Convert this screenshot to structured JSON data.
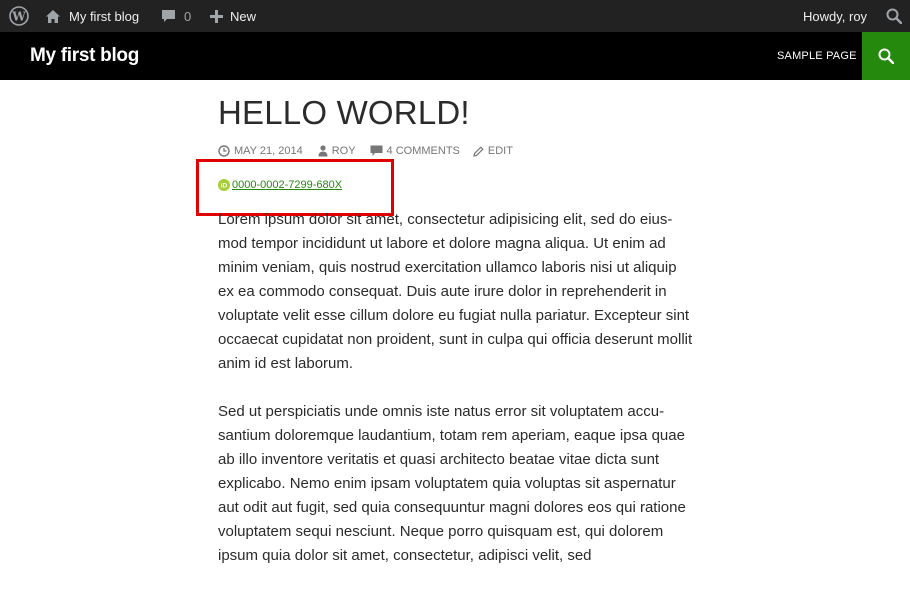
{
  "adminbar": {
    "site_name": "My first blog",
    "comments_count": "0",
    "new_label": "New",
    "howdy": "Howdy, roy",
    "icons": [
      "wordpress-icon",
      "home-icon",
      "comment-icon",
      "plus-icon",
      "search-icon"
    ]
  },
  "header": {
    "site_title": "My first blog",
    "nav": [
      "SAMPLE PAGE"
    ],
    "accent_color": "#24890d"
  },
  "post": {
    "title": "HELLO WORLD!",
    "date": "MAY 21, 2014",
    "author": "ROY",
    "comments": "4 COMMENTS",
    "edit": "EDIT",
    "orcid": "0000-0002-7299-680X",
    "paragraphs": [
      "Lorem ipsum dolor sit amet, consectetur adipisicing elit, sed do eius­mod tempor incididunt ut labore et dolore magna aliqua. Ut enim ad minim veniam, quis nostrud exercitation ullamco laboris nisi ut aliquip ex ea commodo consequat. Duis aute irure dolor in reprehen­derit in voluptate velit esse cillum dolore eu fugiat nulla pariatur. Ex­cepteur sint occaecat cupidatat non proident, sunt in culpa qui offi­cia deserunt mollit anim id est laborum.",
      "Sed ut perspiciatis unde omnis iste natus error sit voluptatem accu­santium doloremque laudantium, totam rem aperiam, eaque ipsa quae ab illo inventore veritatis et quasi architecto beatae vitae dicta sunt explicabo. Nemo enim ipsam voluptatem quia voluptas sit as­pernatur aut odit aut fugit, sed quia consequuntur magni dolores eos qui ratione voluptatem sequi nesciunt. Neque porro quisquam est, qui dolorem ipsum quia dolor sit amet, consectetur, adipisci velit, sed"
    ]
  },
  "highlight_color": "#e00000"
}
